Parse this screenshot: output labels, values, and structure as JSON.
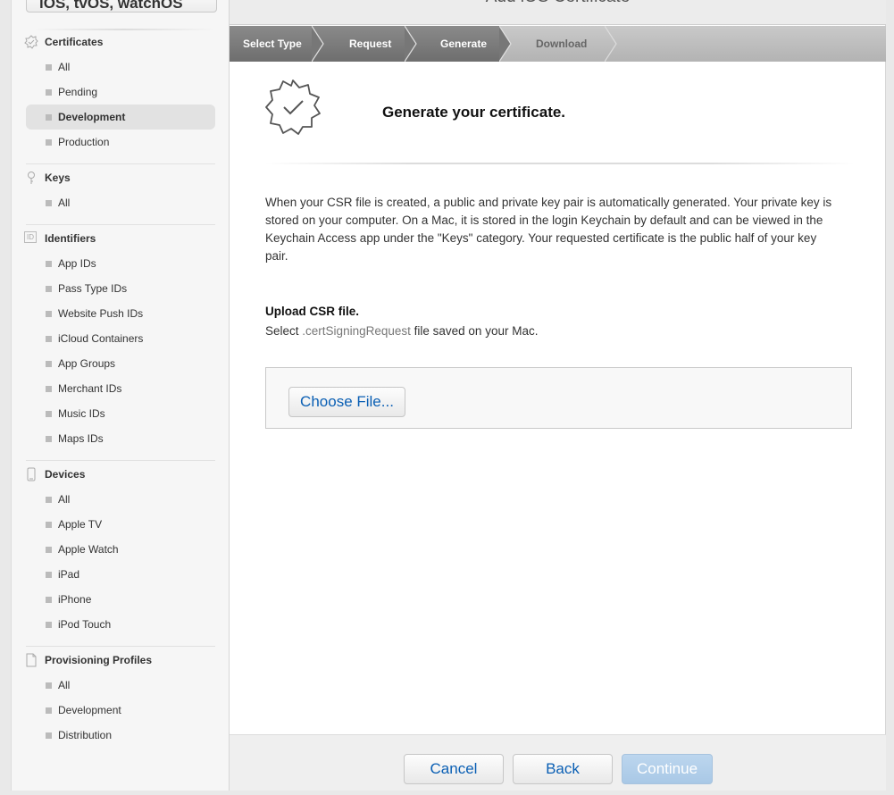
{
  "platform_selector": {
    "label": "iOS, tvOS, watchOS"
  },
  "sidebar": {
    "sections": [
      {
        "title": "Certificates",
        "icon": "certificate-icon",
        "items": [
          "All",
          "Pending",
          "Development",
          "Production"
        ]
      },
      {
        "title": "Keys",
        "icon": "key-icon",
        "items": [
          "All"
        ]
      },
      {
        "title": "Identifiers",
        "icon": "id-icon",
        "icon_text": "ID",
        "items": [
          "App IDs",
          "Pass Type IDs",
          "Website Push IDs",
          "iCloud Containers",
          "App Groups",
          "Merchant IDs",
          "Music IDs",
          "Maps IDs"
        ]
      },
      {
        "title": "Devices",
        "icon": "device-icon",
        "items": [
          "All",
          "Apple TV",
          "Apple Watch",
          "iPad",
          "iPhone",
          "iPod Touch"
        ]
      },
      {
        "title": "Provisioning Profiles",
        "icon": "document-icon",
        "items": [
          "All",
          "Development",
          "Distribution"
        ]
      }
    ],
    "active_item": "Development"
  },
  "main": {
    "title": "Add iOS Certificate",
    "steps": [
      {
        "label": "Select Type",
        "state": "done"
      },
      {
        "label": "Request",
        "state": "done"
      },
      {
        "label": "Generate",
        "state": "current"
      },
      {
        "label": "Download",
        "state": "pending"
      }
    ],
    "heading": "Generate your certificate.",
    "description": "When your CSR file is created, a public and private key pair is automatically generated. Your private key is stored on your computer. On a Mac, it is stored in the login Keychain by default and can be viewed in the Keychain Access app under the \"Keys\" category. Your requested certificate is the public half of your key pair.",
    "upload_title": "Upload CSR file.",
    "upload_prefix": "Select",
    "upload_ext": ".certSigningRequest",
    "upload_suffix": "file saved on your Mac.",
    "choose_file_label": "Choose File..."
  },
  "footer": {
    "cancel_label": "Cancel",
    "back_label": "Back",
    "continue_label": "Continue",
    "continue_enabled": false
  },
  "colors": {
    "link_blue": "#0a5fb4",
    "step_done": "#7a7a7a",
    "continue_disabled": "#b5d0ea"
  }
}
